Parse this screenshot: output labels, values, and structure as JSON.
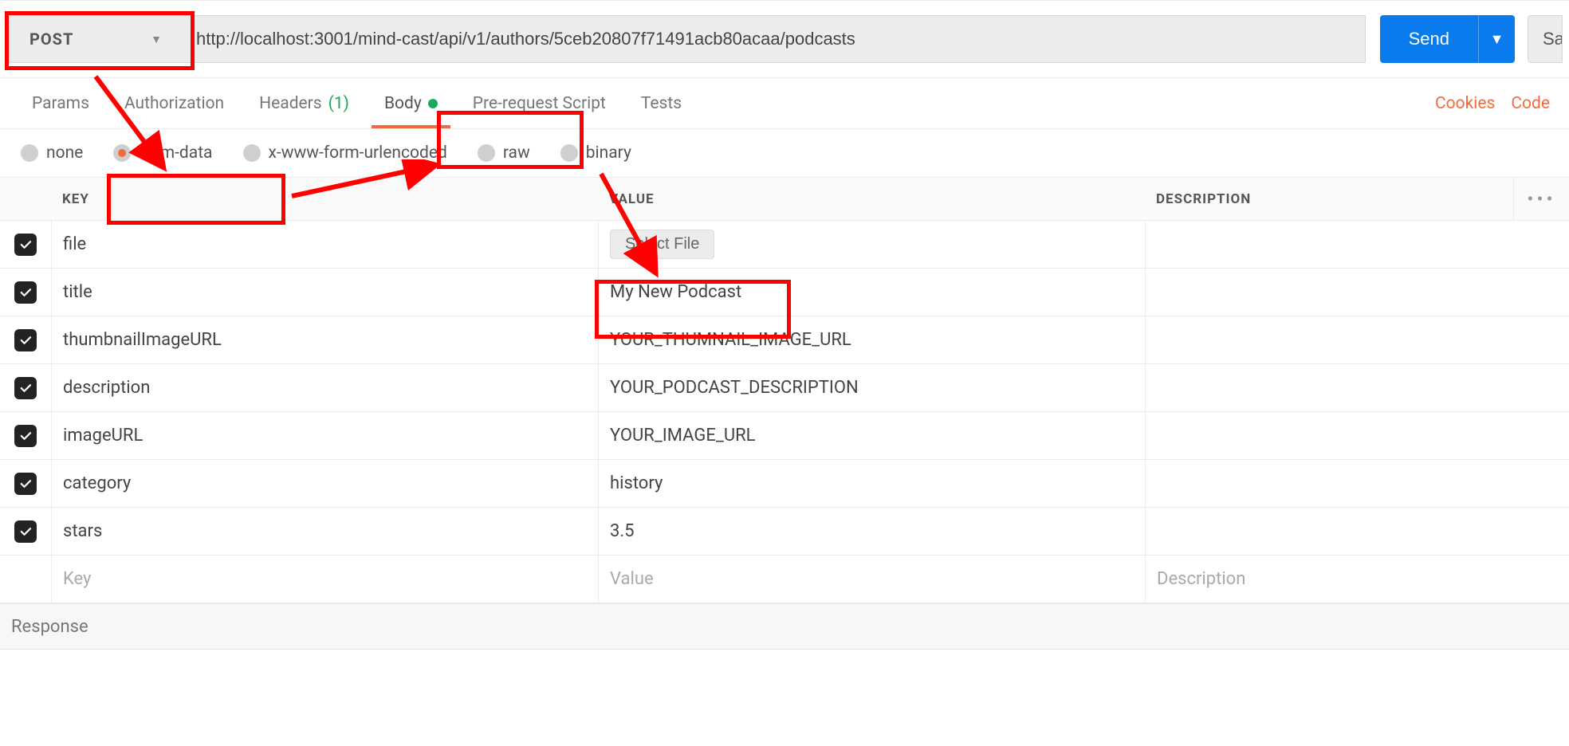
{
  "request": {
    "method": "POST",
    "url": "http://localhost:3001/mind-cast/api/v1/authors/5ceb20807f71491acb80acaa/podcasts",
    "send_label": "Send",
    "save_label": "Save"
  },
  "tabs": {
    "params": "Params",
    "authorization": "Authorization",
    "headers": "Headers",
    "headers_count": "(1)",
    "body": "Body",
    "prerequest": "Pre-request Script",
    "tests": "Tests",
    "cookies": "Cookies",
    "code": "Code"
  },
  "body_types": {
    "none": "none",
    "form_data": "form-data",
    "urlencoded": "x-www-form-urlencoded",
    "raw": "raw",
    "binary": "binary"
  },
  "table": {
    "headers": {
      "key": "KEY",
      "value": "VALUE",
      "description": "DESCRIPTION"
    },
    "select_file": "Select File",
    "rows": [
      {
        "key": "file",
        "value": "",
        "file": true
      },
      {
        "key": "title",
        "value": "My New Podcast"
      },
      {
        "key": "thumbnailImageURL",
        "value": "YOUR_THUMNAIL_IMAGE_URL"
      },
      {
        "key": "description",
        "value": "YOUR_PODCAST_DESCRIPTION"
      },
      {
        "key": "imageURL",
        "value": "YOUR_IMAGE_URL"
      },
      {
        "key": "category",
        "value": "history"
      },
      {
        "key": "stars",
        "value": "3.5"
      }
    ],
    "placeholder": {
      "key": "Key",
      "value": "Value",
      "description": "Description"
    }
  },
  "response": {
    "label": "Response"
  }
}
